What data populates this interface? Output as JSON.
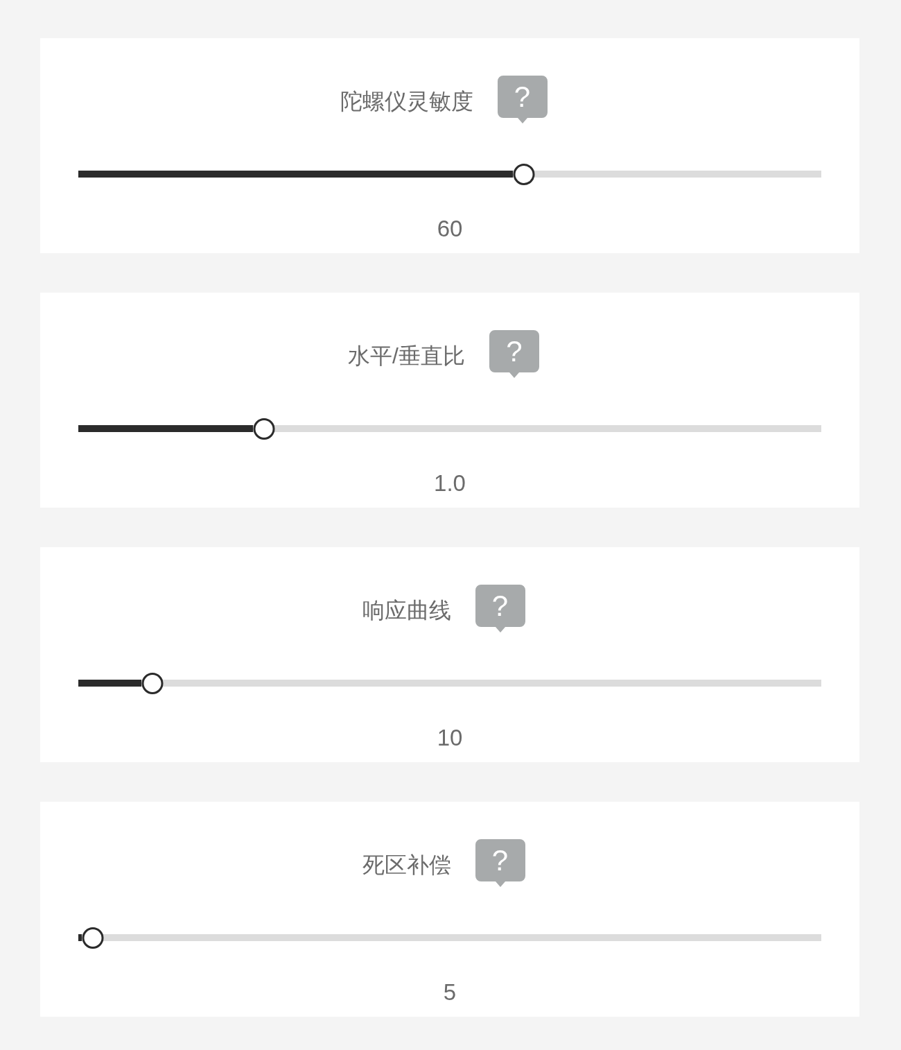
{
  "settings": [
    {
      "label": "陀螺仪灵敏度",
      "help": "?",
      "level": 0.6,
      "value": "60"
    },
    {
      "label": "水平/垂直比",
      "help": "?",
      "level": 0.25,
      "value": "1.0"
    },
    {
      "label": "响应曲线",
      "help": "?",
      "level": 0.1,
      "value": "10"
    },
    {
      "label": "死区补偿",
      "help": "?",
      "level": 0.02,
      "value": "5"
    }
  ]
}
